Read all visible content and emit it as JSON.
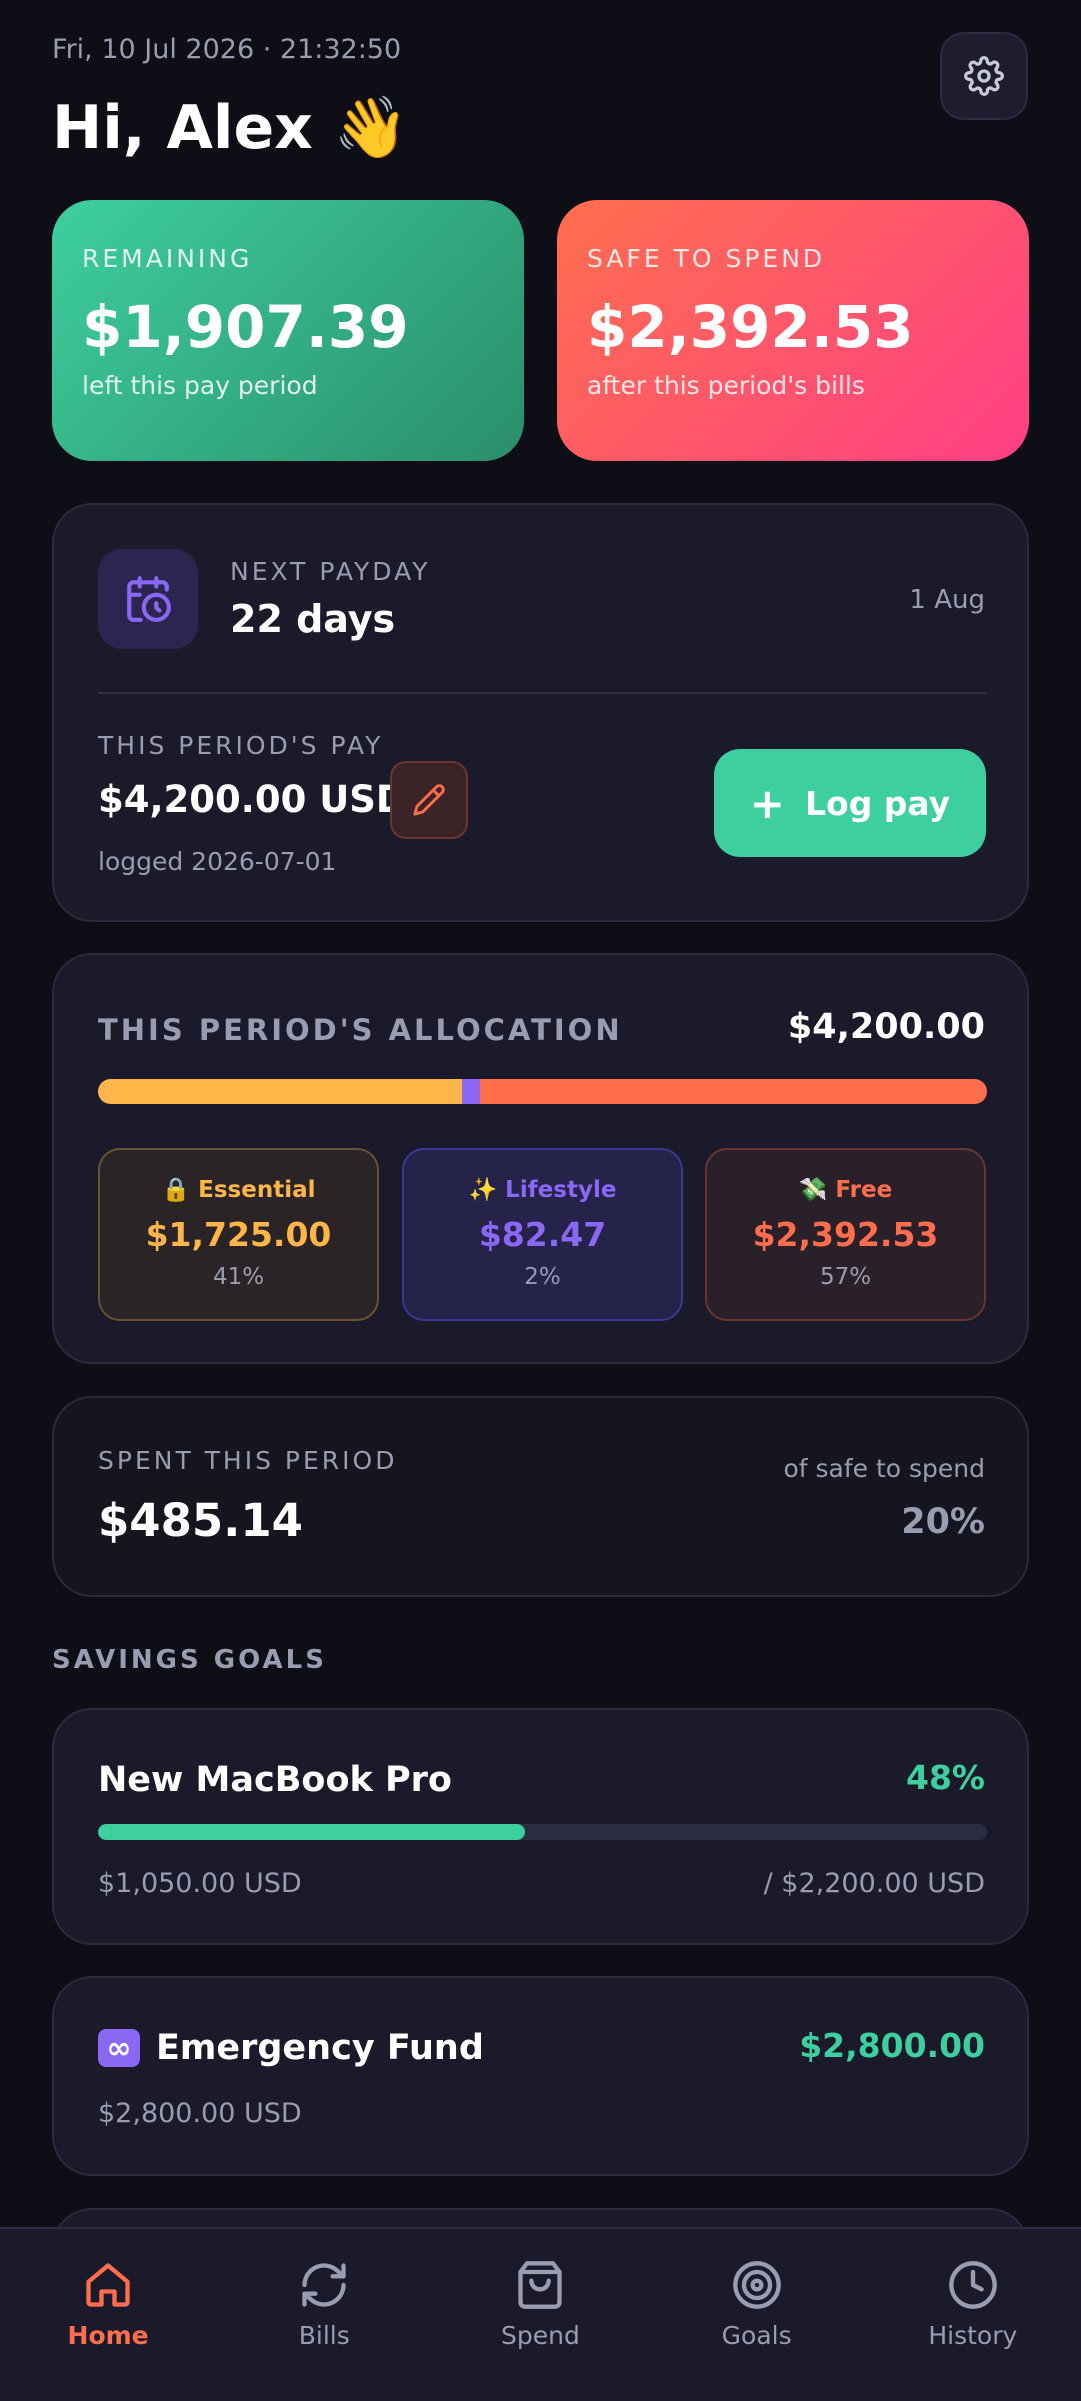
{
  "header": {
    "datetime": "Fri, 10 Jul 2026 · 21:32:50",
    "greeting": "Hi, Alex 👋",
    "settings_icon": "gear-icon"
  },
  "summary": {
    "remaining": {
      "label": "REMAINING",
      "amount": "$1,907.39",
      "sub": "left this pay period"
    },
    "safe_to_spend": {
      "label": "SAFE TO SPEND",
      "amount": "$2,392.53",
      "sub": "after this period's bills"
    }
  },
  "payday": {
    "label": "NEXT PAYDAY",
    "days": "22 days",
    "date": "1 Aug",
    "icon": "calendar-clock-icon",
    "pay_label": "THIS PERIOD'S PAY",
    "pay_amount": "$4,200.00 USD",
    "logged": "logged 2026-07-01",
    "log_button": "Log pay"
  },
  "allocation": {
    "title": "THIS PERIOD'S ALLOCATION",
    "total": "$4,200.00",
    "segments": [
      {
        "name": "🔒 Essential",
        "value": "$1,725.00",
        "pct": "41%",
        "fraction": 0.41,
        "color": "#ffb648"
      },
      {
        "name": "✨ Lifestyle",
        "value": "$82.47",
        "pct": "2%",
        "fraction": 0.02,
        "color": "#8b68f4"
      },
      {
        "name": "💸 Free",
        "value": "$2,392.53",
        "pct": "57%",
        "fraction": 0.57,
        "color": "#ff6e4c"
      }
    ]
  },
  "spent": {
    "label": "SPENT THIS PERIOD",
    "amount": "$485.14",
    "sub": "of safe to spend",
    "pct": "20%"
  },
  "goals": {
    "heading": "SAVINGS GOALS",
    "items": [
      {
        "name": "New MacBook Pro",
        "pct": "48%",
        "progress": 0.48,
        "saved": "$1,050.00 USD",
        "target": "/ $2,200.00 USD"
      },
      {
        "badge": "∞",
        "name": "Emergency Fund",
        "amount": "$2,800.00",
        "saved": "$2,800.00 USD"
      }
    ]
  },
  "nav": {
    "items": [
      {
        "label": "Home",
        "icon": "home-icon",
        "active": true
      },
      {
        "label": "Bills",
        "icon": "refresh-icon",
        "active": false
      },
      {
        "label": "Spend",
        "icon": "shopping-bag-icon",
        "active": false
      },
      {
        "label": "Goals",
        "icon": "target-icon",
        "active": false
      },
      {
        "label": "History",
        "icon": "clock-icon",
        "active": false
      }
    ]
  },
  "colors": {
    "accent_green": "#3ecf9e",
    "accent_orange": "#ff6e4c",
    "accent_purple": "#8b68f4",
    "accent_yellow": "#ffb648",
    "background": "#0e0e17",
    "panel": "#1a1a2b"
  }
}
